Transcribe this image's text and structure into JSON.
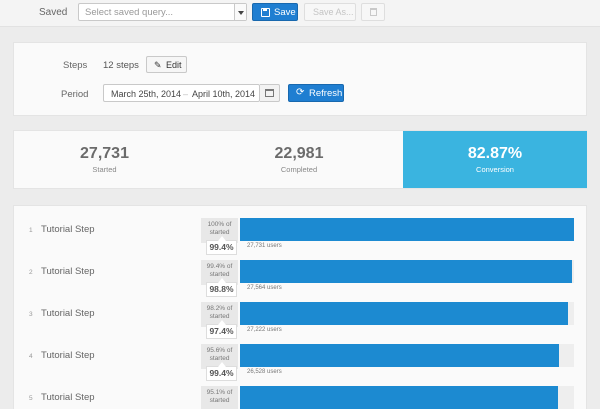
{
  "toolbar": {
    "saved_label": "Saved",
    "query_placeholder": "Select saved query...",
    "save_label": "Save",
    "save_as_label": "Save As..."
  },
  "panel": {
    "steps_label": "Steps",
    "steps_value": "12 steps",
    "edit_label": "Edit",
    "period_label": "Period",
    "date_start": "March 25th, 2014",
    "date_separator": "–",
    "date_end": "April 10th, 2014",
    "refresh_label": "Refresh"
  },
  "stats": {
    "started_value": "27,731",
    "started_label": "Started",
    "completed_value": "22,981",
    "completed_label": "Completed",
    "conversion_value": "82.87%",
    "conversion_label": "Conversion"
  },
  "funnel": {
    "steps": [
      {
        "num": "1",
        "name": "Tutorial Step",
        "pct_line1": "100% of",
        "pct_line2": "started",
        "users": "27,731 users",
        "drop": "99.4%",
        "fill": 1.0
      },
      {
        "num": "2",
        "name": "Tutorial Step",
        "pct_line1": "99.4% of",
        "pct_line2": "started",
        "users": "27,564 users",
        "drop": "98.8%",
        "fill": 0.994
      },
      {
        "num": "3",
        "name": "Tutorial Step",
        "pct_line1": "98.2% of",
        "pct_line2": "started",
        "users": "27,222 users",
        "drop": "97.4%",
        "fill": 0.982
      },
      {
        "num": "4",
        "name": "Tutorial Step",
        "pct_line1": "95.6% of",
        "pct_line2": "started",
        "users": "26,528 users",
        "drop": "99.4%",
        "fill": 0.956
      },
      {
        "num": "5",
        "name": "Tutorial Step",
        "pct_line1": "95.1% of",
        "pct_line2": "started",
        "users": "",
        "drop": "",
        "fill": 0.951
      }
    ]
  },
  "colors": {
    "primary_button": "#1f7ed1",
    "bar": "#1c8ad1",
    "conversion_bg": "#3ab4e0"
  }
}
